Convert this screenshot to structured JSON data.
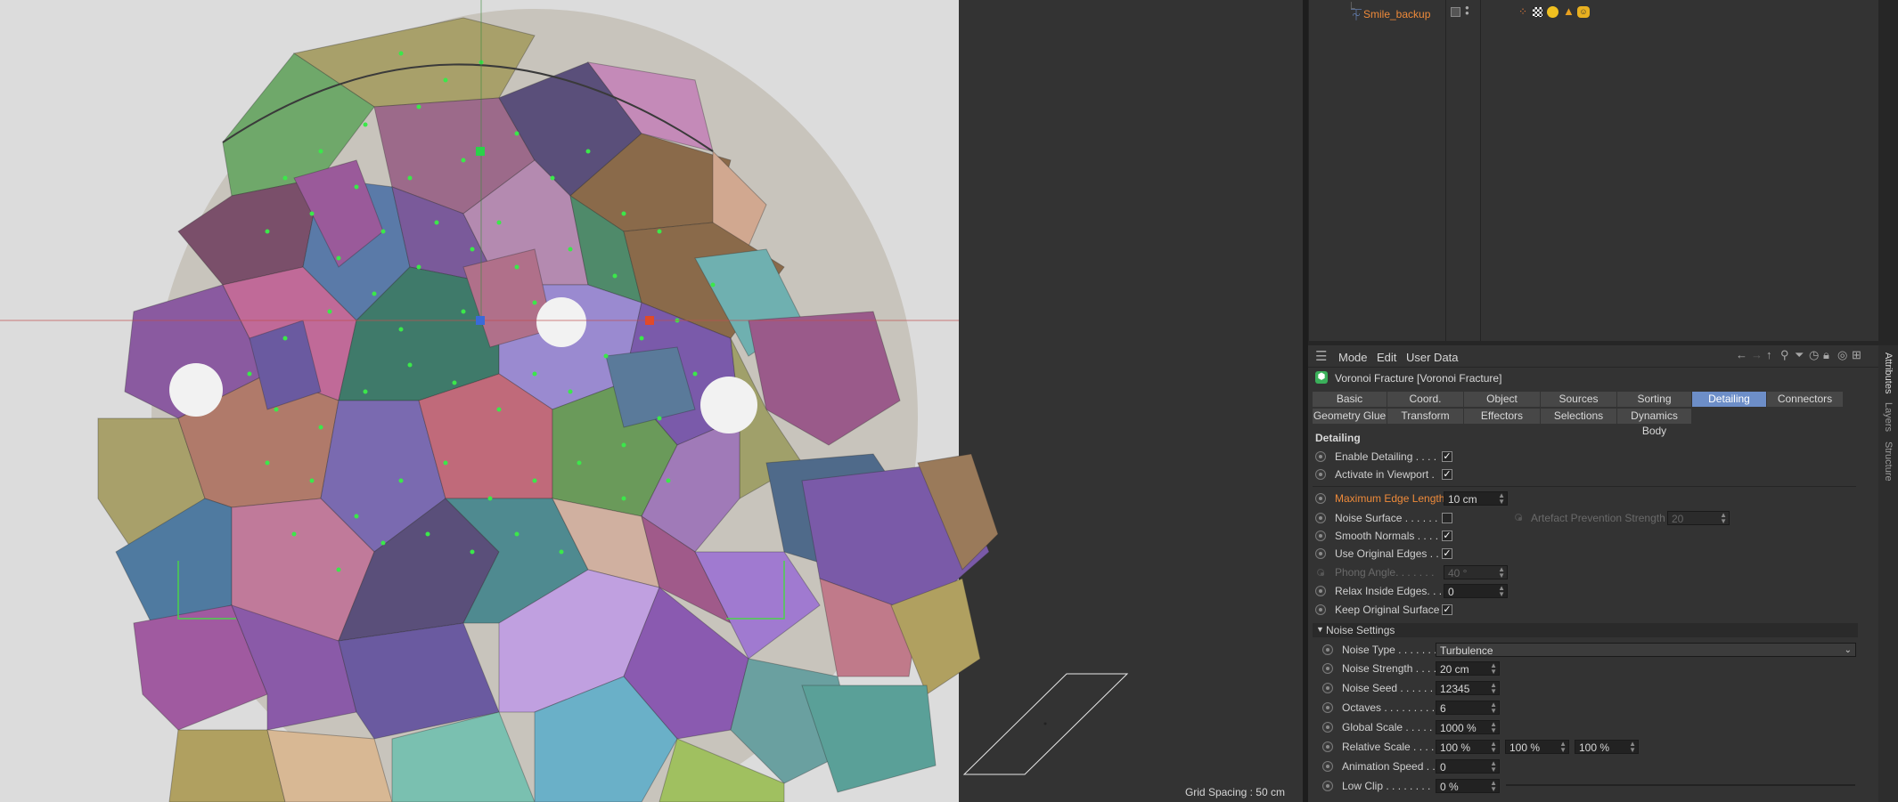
{
  "object_manager": {
    "object_name": "Smile_backup"
  },
  "viewport": {
    "grid_spacing": "Grid Spacing : 50 cm"
  },
  "attributes": {
    "menu": [
      "Mode",
      "Edit",
      "User Data"
    ],
    "object_title": "Voronoi Fracture [Voronoi Fracture]",
    "tabs_row1": [
      "Basic",
      "Coord.",
      "Object",
      "Sources",
      "Sorting",
      "Detailing",
      "Connectors"
    ],
    "tabs_row2": [
      "Geometry Glue",
      "Transform",
      "Effectors",
      "Selections",
      "Dynamics Body"
    ],
    "active_tab": "Detailing",
    "section_title": "Detailing",
    "enable_detailing": "Enable Detailing . . . .",
    "activate_in_viewport": "Activate in Viewport .",
    "max_edge_length_label": "Maximum Edge Length",
    "max_edge_length_value": "10 cm",
    "noise_surface": "Noise Surface . . . . . .",
    "artefact_label": "Artefact Prevention Strength",
    "artefact_value": "20",
    "smooth_normals": "Smooth Normals . . . .",
    "use_original_edges": "Use Original Edges . .",
    "phong_angle_label": "Phong Angle. . . . . . .",
    "phong_angle_value": "40 °",
    "relax_inside_edges_label": "Relax Inside Edges. . .",
    "relax_inside_edges_value": "0",
    "keep_original_surface": "Keep Original Surface",
    "noise_settings_title": "Noise Settings",
    "noise_type_label": "Noise Type . . . . . . .",
    "noise_type_value": "Turbulence",
    "noise_strength_label": "Noise Strength . . . .",
    "noise_strength_value": "20 cm",
    "noise_seed_label": "Noise Seed . . . . . . .",
    "noise_seed_value": "12345",
    "octaves_label": "Octaves . . . . . . . . .",
    "octaves_value": "6",
    "global_scale_label": "Global Scale . . . . . .",
    "global_scale_value": "1000 %",
    "relative_scale_label": "Relative Scale . . . . .",
    "relative_scale_x": "100 %",
    "relative_scale_y": "100 %",
    "relative_scale_z": "100 %",
    "animation_speed_label": "Animation Speed . .",
    "animation_speed_value": "0",
    "low_clip_label": "Low Clip . . . . . . . .",
    "low_clip_value": "0 %"
  },
  "side_tabs": [
    "Attributes",
    "Layers",
    "Structure"
  ]
}
